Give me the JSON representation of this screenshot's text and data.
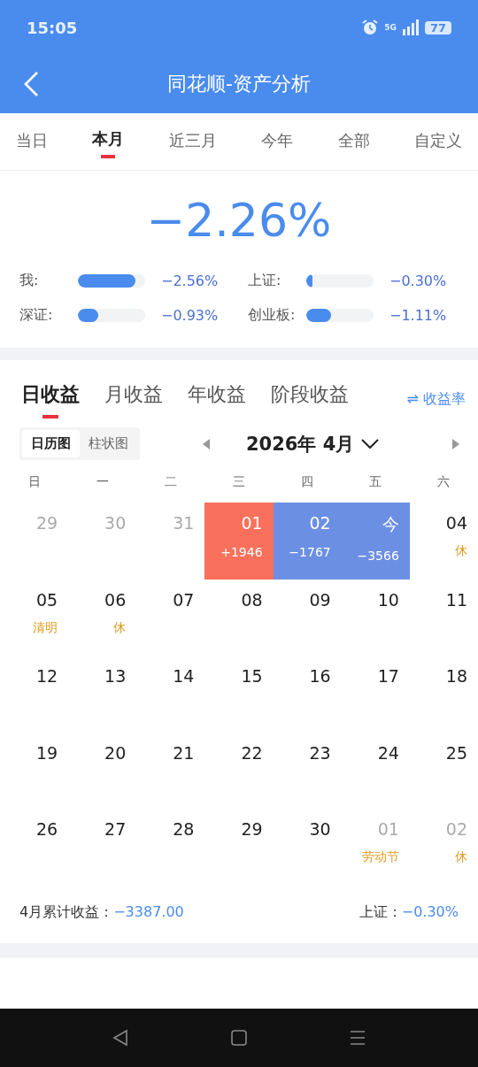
{
  "status_bar": {
    "time": "15:05",
    "network": "5G",
    "battery": "77"
  },
  "header": {
    "title": "同花顺-资产分析"
  },
  "tabs": [
    {
      "label": "当日",
      "selected": false
    },
    {
      "label": "本月",
      "selected": true
    },
    {
      "label": "近三月",
      "selected": false
    },
    {
      "label": "今年",
      "selected": false
    },
    {
      "label": "全部",
      "selected": false
    },
    {
      "label": "自定义",
      "selected": false
    }
  ],
  "summary": {
    "value": "−2.26%",
    "bars": [
      {
        "label": "我:",
        "level": 0.85,
        "reading": "−2.56%"
      },
      {
        "label": "上证:",
        "level": 0.09,
        "reading": "−0.30%"
      },
      {
        "label": "深证:",
        "level": 0.3,
        "reading": "−0.93%"
      },
      {
        "label": "创业板:",
        "level": 0.37,
        "reading": "−1.11%"
      }
    ]
  },
  "earnings_tabs": [
    {
      "label": "日收益",
      "selected": true
    },
    {
      "label": "月收益",
      "selected": false
    },
    {
      "label": "年收益",
      "selected": false
    },
    {
      "label": "阶段收益",
      "selected": false
    }
  ],
  "switch_link": {
    "icon": "⇌",
    "label": "收益率"
  },
  "view_toggle": [
    {
      "label": "日历图",
      "selected": true
    },
    {
      "label": "柱状图",
      "selected": false
    }
  ],
  "month": {
    "label": "2026年 4月"
  },
  "weekdays": [
    "日",
    "一",
    "二",
    "三",
    "四",
    "五",
    "六"
  ],
  "days": [
    {
      "day": "29",
      "muted": true
    },
    {
      "day": "30",
      "muted": true
    },
    {
      "day": "31",
      "muted": true
    },
    {
      "day": "01",
      "muted": false,
      "profit": "+1946",
      "color": "#f9715c"
    },
    {
      "day": "02",
      "muted": false,
      "profit": "−1767",
      "color": "#6b8fe3"
    },
    {
      "day": "今",
      "muted": false,
      "profit": "−3566",
      "color": "#6b8fe3"
    },
    {
      "day": "04",
      "muted": false,
      "note": "休"
    },
    {
      "day": "05",
      "muted": false,
      "note": "清明"
    },
    {
      "day": "06",
      "muted": false,
      "note": "休"
    },
    {
      "day": "07",
      "muted": false
    },
    {
      "day": "08",
      "muted": false
    },
    {
      "day": "09",
      "muted": false
    },
    {
      "day": "10",
      "muted": false
    },
    {
      "day": "11",
      "muted": false
    },
    {
      "day": "12",
      "muted": false
    },
    {
      "day": "13",
      "muted": false
    },
    {
      "day": "14",
      "muted": false
    },
    {
      "day": "15",
      "muted": false
    },
    {
      "day": "16",
      "muted": false
    },
    {
      "day": "17",
      "muted": false
    },
    {
      "day": "18",
      "muted": false
    },
    {
      "day": "19",
      "muted": false
    },
    {
      "day": "20",
      "muted": false
    },
    {
      "day": "21",
      "muted": false
    },
    {
      "day": "22",
      "muted": false
    },
    {
      "day": "23",
      "muted": false
    },
    {
      "day": "24",
      "muted": false
    },
    {
      "day": "25",
      "muted": false
    },
    {
      "day": "26",
      "muted": false
    },
    {
      "day": "27",
      "muted": false
    },
    {
      "day": "28",
      "muted": false
    },
    {
      "day": "29",
      "muted": false
    },
    {
      "day": "30",
      "muted": false
    },
    {
      "day": "01",
      "muted": true,
      "note": "劳动节"
    },
    {
      "day": "02",
      "muted": true,
      "note": "休"
    }
  ],
  "footer": {
    "total_label": "4月累计收益：",
    "total_value": "−3387.00",
    "index_label": "上证：",
    "index_value": "−0.30%"
  }
}
